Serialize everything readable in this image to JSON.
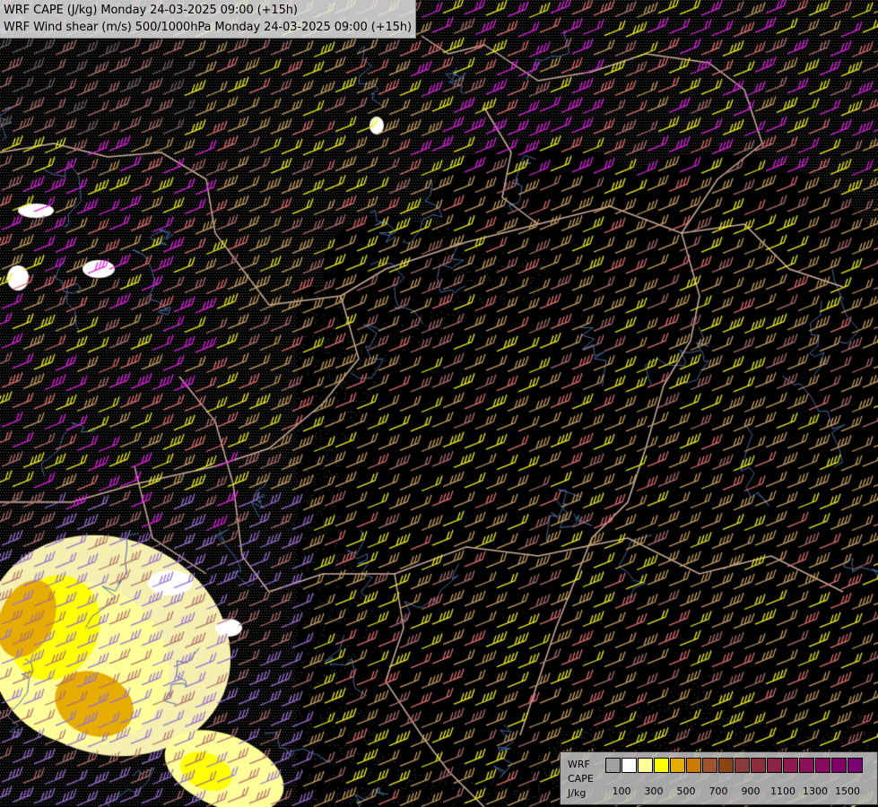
{
  "title": {
    "line1": "WRF CAPE (J/kg) Monday 24-03-2025 09:00 (+15h)",
    "line2": "WRF Wind shear (m/s) 500/1000hPa Monday 24-03-2025 09:00 (+15h)"
  },
  "legend": {
    "label_model": "WRF",
    "label_var": "CAPE",
    "label_unit": "J/kg",
    "colors": [
      "#a0a0a0",
      "#ffffff",
      "#ffff99",
      "#ffff00",
      "#e6ad00",
      "#cc7a00",
      "#a0522d",
      "#8b4513",
      "#8b3a3a",
      "#8b2e3a",
      "#8b2345",
      "#8b1a4e",
      "#8b1058",
      "#870a60",
      "#800068",
      "#780070"
    ],
    "ticks": [
      "100",
      "300",
      "500",
      "700",
      "900",
      "1100",
      "1300",
      "1500"
    ]
  },
  "colors": {
    "shear_magenta": "#e020e0",
    "shear_yellow": "#f0f020",
    "shear_tan": "#c8a060",
    "shear_salmon": "#e07070",
    "shear_mauve": "#b07070",
    "shear_violet": "#9a70d0",
    "borders": "#d0b0a0",
    "rivers": "#4a6aa0"
  }
}
